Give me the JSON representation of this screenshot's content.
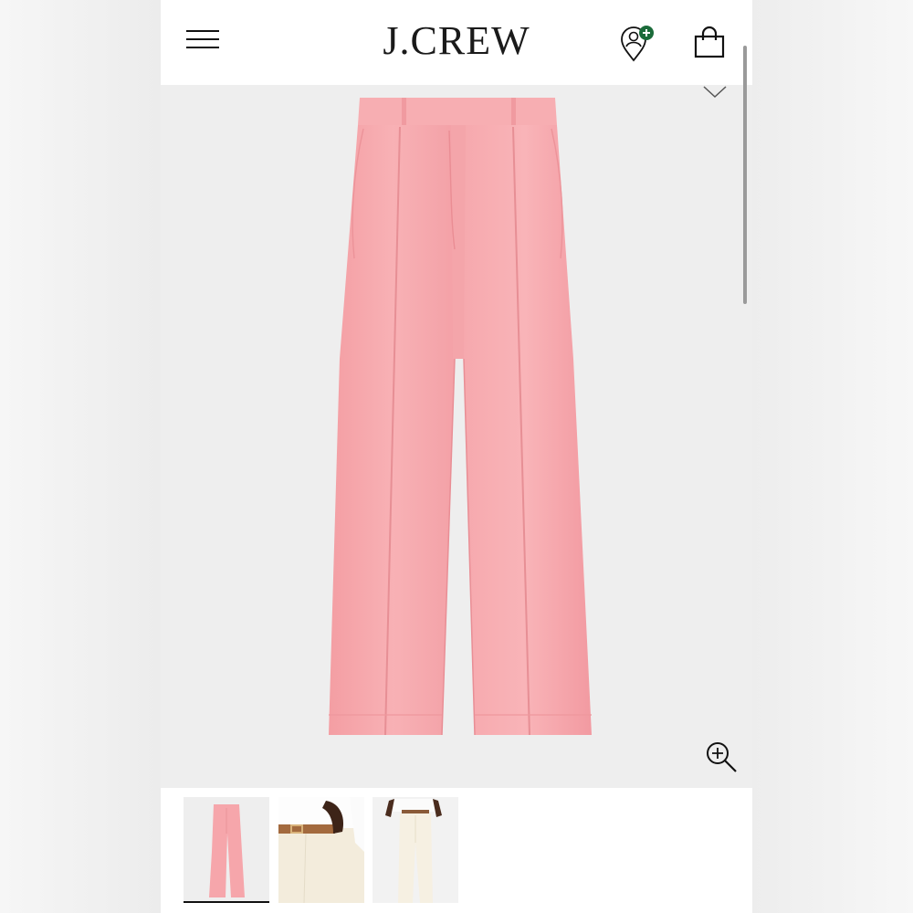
{
  "header": {
    "brand": "J.CREW",
    "menu_icon": "hamburger-menu-icon",
    "account_icon": "account-location-plus-icon",
    "bag_icon": "shopping-bag-icon"
  },
  "hero": {
    "chevron_icon": "chevron-down-icon",
    "zoom_icon": "zoom-in-icon",
    "product_color": "#f6a9ac"
  },
  "thumbnails": {
    "count": 3,
    "selected_index": 0
  },
  "colors": {
    "accent_green": "#1b6b3a",
    "text_dark": "#111111"
  }
}
